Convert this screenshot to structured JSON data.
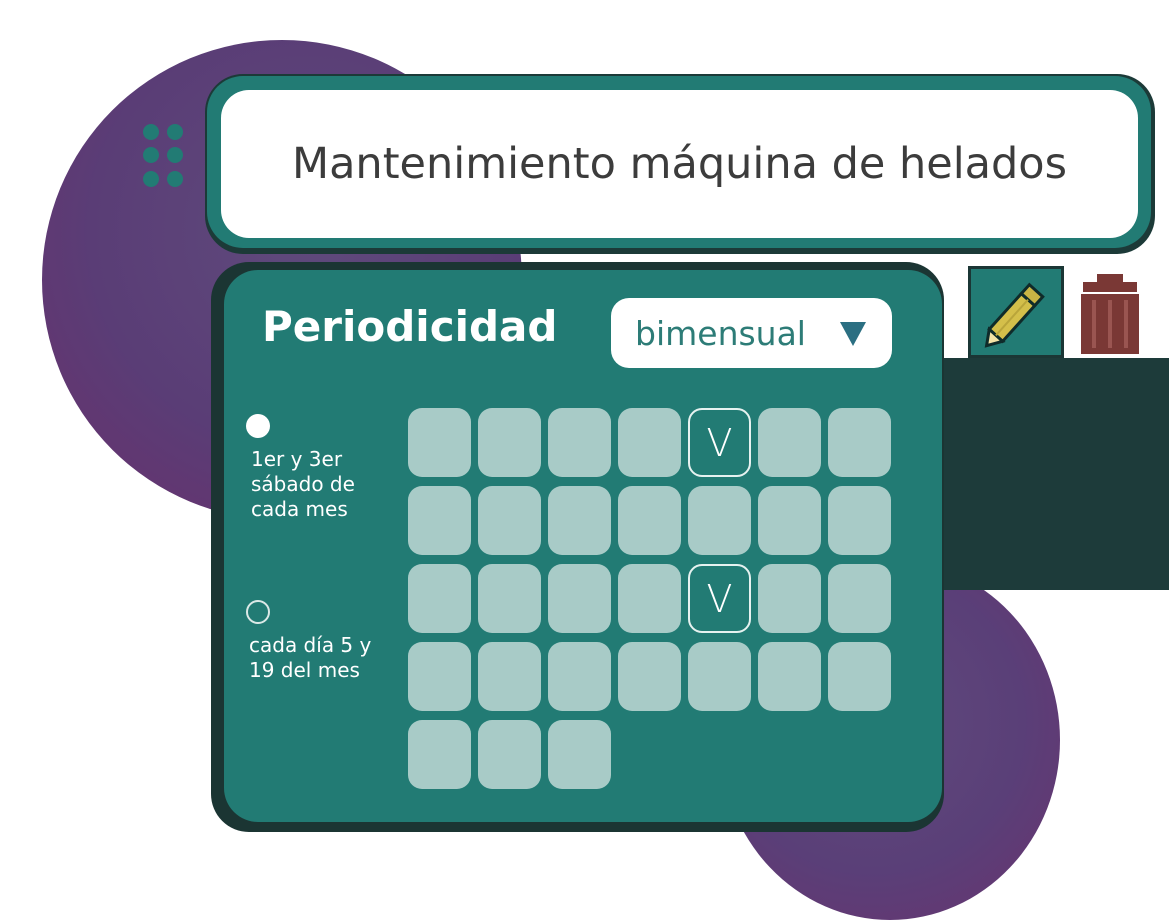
{
  "colors": {
    "teal": "#227b74",
    "dark_teal": "#1b3533",
    "cell": "#a8cbc7",
    "purple": "#5a3d76",
    "pencil": "#d4bf4a",
    "trash": "#7a3835"
  },
  "title": "Mantenimiento máquina de helados",
  "toolbar": {
    "edit_icon": "pencil-icon",
    "delete_icon": "trash-icon"
  },
  "periodicity": {
    "label": "Periodicidad",
    "select_value": "bimensual",
    "options": [
      {
        "label": "1er y 3er\nsábado de\ncada mes",
        "selected": true
      },
      {
        "label": "cada día 5  y\n19 del mes",
        "selected": false
      }
    ]
  },
  "calendar": {
    "mark": "V",
    "cells": [
      {
        "s": false
      },
      {
        "s": false
      },
      {
        "s": false
      },
      {
        "s": false
      },
      {
        "s": true
      },
      {
        "s": false
      },
      {
        "s": false
      },
      {
        "s": false
      },
      {
        "s": false
      },
      {
        "s": false
      },
      {
        "s": false
      },
      {
        "s": false
      },
      {
        "s": false
      },
      {
        "s": false
      },
      {
        "s": false
      },
      {
        "s": false
      },
      {
        "s": false
      },
      {
        "s": false
      },
      {
        "s": true
      },
      {
        "s": false
      },
      {
        "s": false
      },
      {
        "s": false
      },
      {
        "s": false
      },
      {
        "s": false
      },
      {
        "s": false
      },
      {
        "s": false
      },
      {
        "s": false
      },
      {
        "s": false
      },
      {
        "s": false
      },
      {
        "s": false
      },
      {
        "s": false
      }
    ]
  }
}
